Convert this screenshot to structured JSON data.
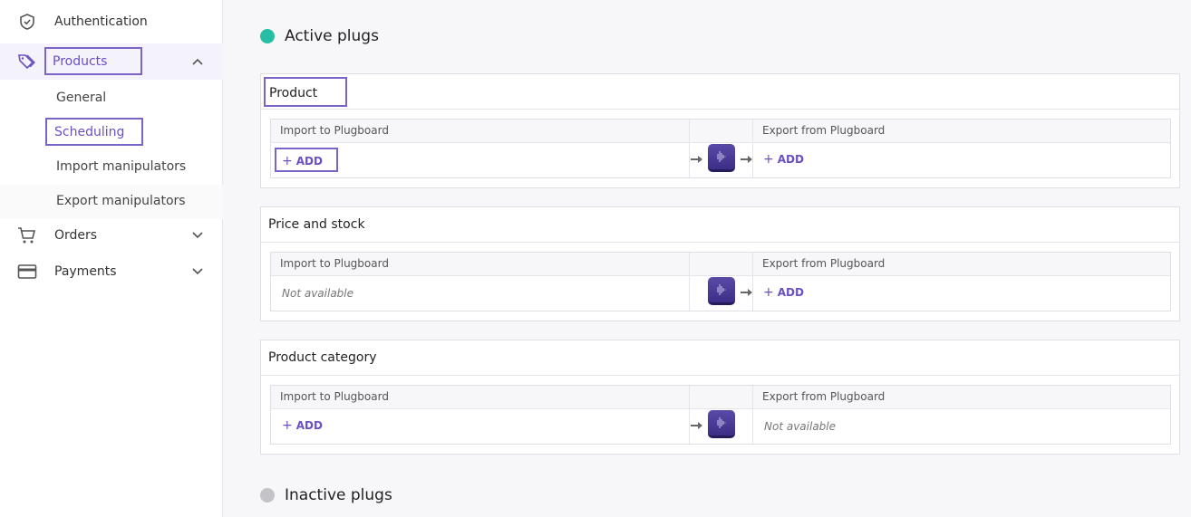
{
  "sidebar": {
    "items": [
      {
        "label": "Authentication",
        "icon": "shield-check-icon"
      },
      {
        "label": "Products",
        "icon": "tag-icon"
      },
      {
        "label": "Orders",
        "icon": "cart-icon"
      },
      {
        "label": "Payments",
        "icon": "credit-card-icon"
      }
    ],
    "products_sub": [
      {
        "label": "General"
      },
      {
        "label": "Scheduling"
      },
      {
        "label": "Import manipulators"
      },
      {
        "label": "Export manipulators"
      }
    ]
  },
  "main": {
    "active_title": "Active plugs",
    "inactive_title": "Inactive plugs",
    "import_header": "Import to Plugboard",
    "export_header": "Export from Plugboard",
    "add_label": "ADD",
    "not_available": "Not available",
    "cards": [
      {
        "title": "Product"
      },
      {
        "title": "Price and stock"
      },
      {
        "title": "Product category"
      }
    ]
  },
  "colors": {
    "accent": "#6b4fc3",
    "active_dot": "#26bfa6",
    "inactive_dot": "#c4c4c8"
  }
}
